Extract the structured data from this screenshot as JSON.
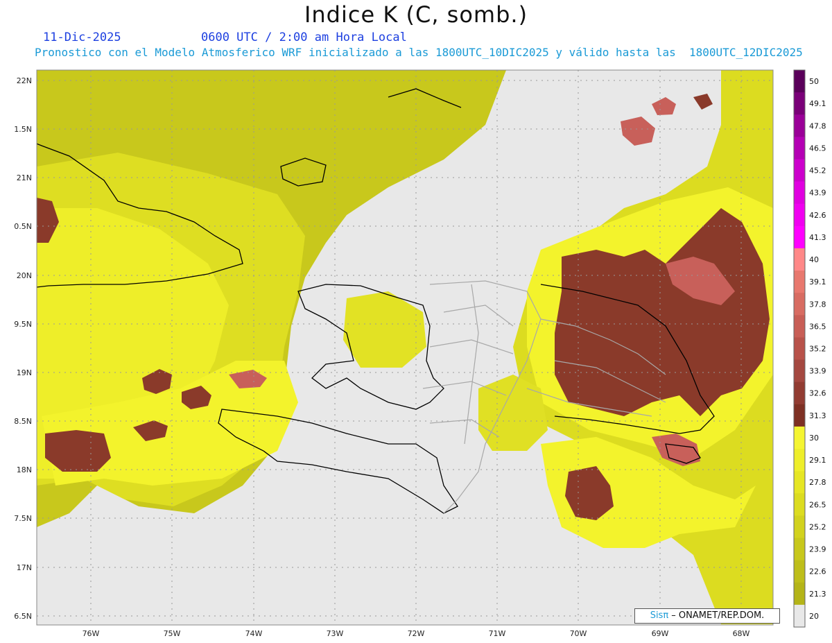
{
  "header": {
    "title": "Indice K (C, somb.)",
    "date": "11-Dic-2025",
    "time": "0600 UTC / 2:00 am Hora Local",
    "description": "Pronostico con el Modelo Atmosferico WRF inicializado a las 1800UTC_10DIC2025 y válido hasta las  1800UTC_12DIC2025"
  },
  "map": {
    "lat_labels": [
      "22N",
      "1.5N",
      "21N",
      "0.5N",
      "20N",
      "9.5N",
      "19N",
      "8.5N",
      "18N",
      "7.5N",
      "17N",
      "6.5N"
    ],
    "lon_labels": [
      "76W",
      "75W",
      "74W",
      "73W",
      "72W",
      "71W",
      "70W",
      "69W",
      "68W"
    ],
    "colors": {
      "background": "#e8e8e8",
      "low": "#c2c21a",
      "mid": "#d8d821",
      "high": "#f3f32c",
      "hot": "#8a3a2a",
      "hotter": "#c8605a",
      "extreme": "#f000f0"
    }
  },
  "colorbar": {
    "labels": [
      "50",
      "49.1",
      "47.8",
      "46.5",
      "45.2",
      "43.9",
      "42.6",
      "41.3",
      "40",
      "39.1",
      "37.8",
      "36.5",
      "35.2",
      "33.9",
      "32.6",
      "31.3",
      "30",
      "29.1",
      "27.8",
      "26.5",
      "25.2",
      "23.9",
      "22.6",
      "21.3",
      "20"
    ],
    "colors": [
      "#5a005a",
      "#7a0078",
      "#9a0098",
      "#b400b4",
      "#cc00cc",
      "#e000e0",
      "#f000f0",
      "#ff00ff",
      "#ff8888",
      "#e8786e",
      "#d86c62",
      "#c85e56",
      "#b8524a",
      "#a44840",
      "#923c32",
      "#7e3024",
      "#f5f532",
      "#eeee2a",
      "#e6e624",
      "#dcdc20",
      "#d2d21e",
      "#c8c81c",
      "#bebe1a",
      "#b4b418",
      "#e8e8e8"
    ]
  },
  "credit": {
    "brand": "Sisπ",
    "org": " – ONAMET/REP.DOM."
  }
}
